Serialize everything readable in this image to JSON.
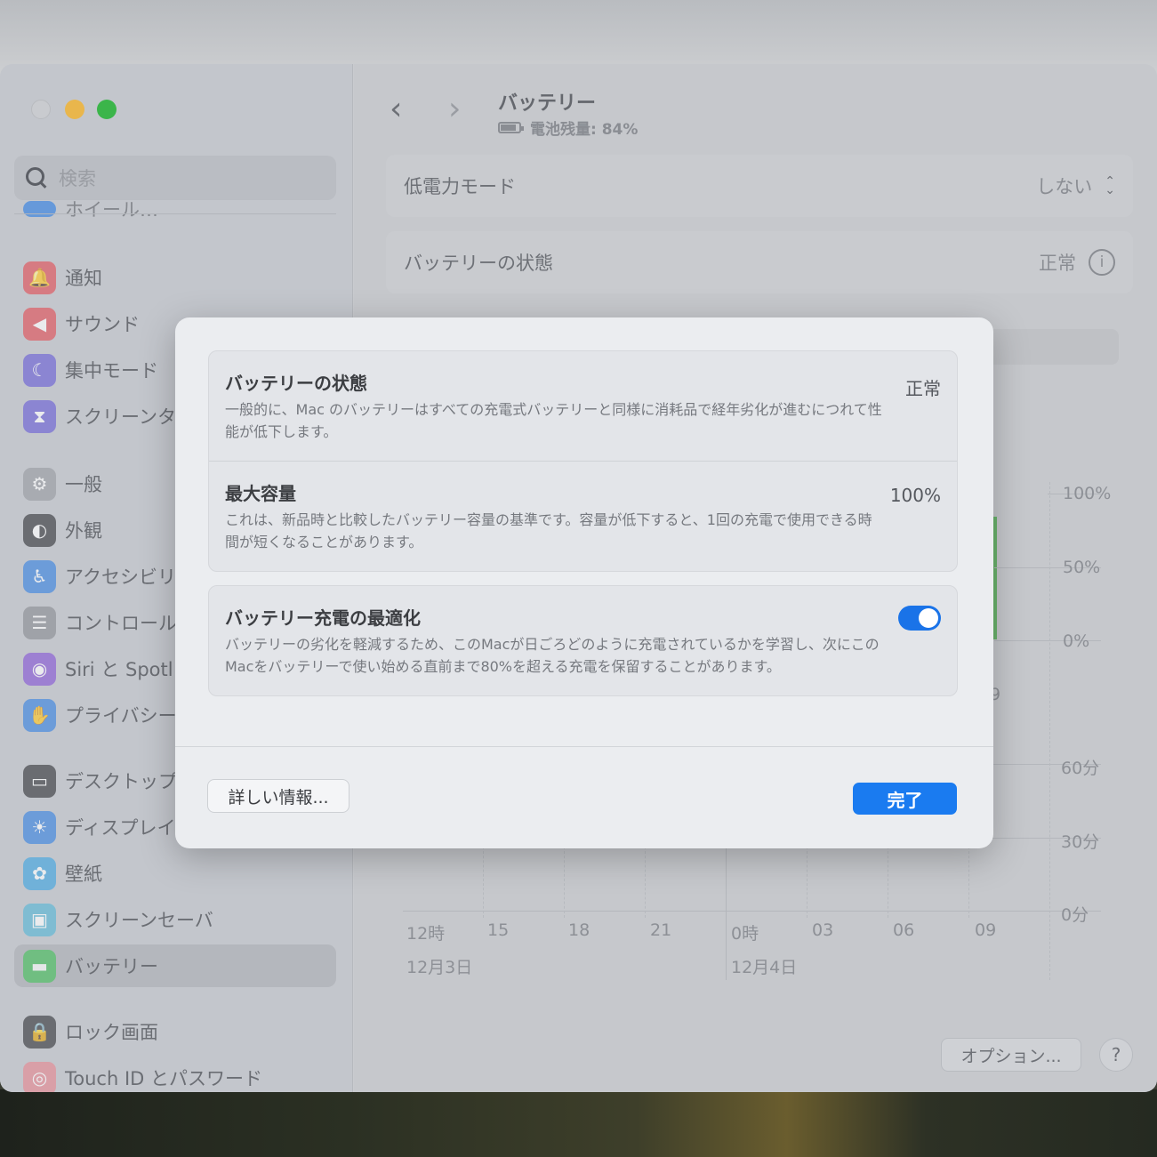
{
  "sidebar": {
    "search_placeholder": "検索",
    "partial_item": "ホイール…",
    "items": [
      {
        "label": "通知",
        "icon": "bell-icon",
        "color": "#e1545b"
      },
      {
        "label": "サウンド",
        "icon": "speaker-icon",
        "color": "#e1545b"
      },
      {
        "label": "集中モード",
        "icon": "moon-icon",
        "color": "#6e63d6"
      },
      {
        "label": "スクリーンタ",
        "icon": "hourglass-icon",
        "color": "#6e63d6"
      },
      {
        "label": "一般",
        "icon": "gear-icon",
        "color": "#9a9da3"
      },
      {
        "label": "外観",
        "icon": "appearance-icon",
        "color": "#3b3d42"
      },
      {
        "label": "アクセシビリ",
        "icon": "accessibility-icon",
        "color": "#3f86e0"
      },
      {
        "label": "コントロール",
        "icon": "control-center-icon",
        "color": "#8d9096"
      },
      {
        "label": "Siri と Spotl",
        "icon": "siri-icon",
        "color": "#8a5bd6"
      },
      {
        "label": "プライバシー",
        "icon": "hand-icon",
        "color": "#3f86e0"
      },
      {
        "label": "デスクトップ",
        "icon": "desktop-icon",
        "color": "#3b3d42"
      },
      {
        "label": "ディスプレイ",
        "icon": "display-icon",
        "color": "#3f86e0"
      },
      {
        "label": "壁紙",
        "icon": "wallpaper-icon",
        "color": "#45a6e0"
      },
      {
        "label": "スクリーンセーバ",
        "icon": "screensaver-icon",
        "color": "#5bb8d6"
      },
      {
        "label": "バッテリー",
        "icon": "battery-icon",
        "color": "#4cc262"
      },
      {
        "label": "ロック画面",
        "icon": "lock-icon",
        "color": "#3b3d42"
      },
      {
        "label": "Touch ID とパスワード",
        "icon": "fingerprint-icon",
        "color": "#e58a94"
      }
    ]
  },
  "header": {
    "title": "バッテリー",
    "subtitle": "電池残量: 84%"
  },
  "settings": {
    "low_power_label": "低電力モード",
    "low_power_value": "しない",
    "health_label": "バッテリーの状態",
    "health_value": "正常"
  },
  "chart": {
    "level_ticks": [
      "100%",
      "50%",
      "0%"
    ],
    "usage_ticks": [
      "60分",
      "30分",
      "0分"
    ],
    "x_ticks": [
      "12時",
      "15",
      "18",
      "21",
      "0時",
      "03",
      "06",
      "09"
    ],
    "dates": [
      "12月3日",
      "12月4日"
    ],
    "partial_label": "9"
  },
  "footer": {
    "options_label": "オプション...",
    "help_label": "?"
  },
  "sheet": {
    "health_title": "バッテリーの状態",
    "health_value": "正常",
    "health_desc": "一般的に、Mac のバッテリーはすべての充電式バッテリーと同様に消耗品で経年劣化が進むにつれて性能が低下します。",
    "capacity_title": "最大容量",
    "capacity_value": "100%",
    "capacity_desc": "これは、新品時と比較したバッテリー容量の基準です。容量が低下すると、1回の充電で使用できる時間が短くなることがあります。",
    "optimize_title": "バッテリー充電の最適化",
    "optimize_desc": "バッテリーの劣化を軽減するため、このMacが日ごろどのように充電されているかを学習し、次にこのMacをバッテリーで使い始める直前まで80%を超える充電を保留することがあります。",
    "optimize_enabled": true,
    "details_label": "詳しい情報...",
    "done_label": "完了"
  }
}
